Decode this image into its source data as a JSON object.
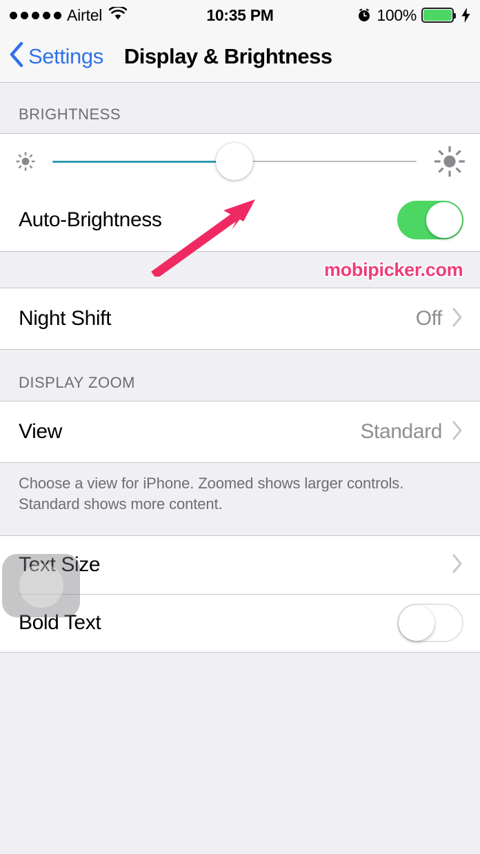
{
  "status_bar": {
    "signal_dots": 5,
    "carrier": "Airtel",
    "wifi_icon": "wifi-icon",
    "time": "10:35 PM",
    "alarm_icon": "alarm-clock-icon",
    "battery_percent": "100%",
    "battery_level": 100,
    "charging_icon": "lightning-bolt-icon",
    "battery_color": "#4cd764"
  },
  "nav_bar": {
    "back_icon": "chevron-left-icon",
    "back_label": "Settings",
    "title": "Display & Brightness",
    "tint_color": "#2f72e8"
  },
  "sections": {
    "brightness": {
      "header": "BRIGHTNESS",
      "slider": {
        "name": "brightness-slider",
        "min_icon": "sun-small-icon",
        "max_icon": "sun-large-icon",
        "value_percent": 50,
        "fill_color": "#2e9bb0",
        "track_color": "#b9b9bd"
      },
      "auto_brightness": {
        "label": "Auto-Brightness",
        "toggle_state": "on",
        "toggle_on_color": "#4cd764"
      }
    },
    "night_shift": {
      "label": "Night Shift",
      "value": "Off",
      "disclosure_icon": "chevron-right-icon"
    },
    "display_zoom": {
      "header": "DISPLAY ZOOM",
      "view": {
        "label": "View",
        "value": "Standard",
        "disclosure_icon": "chevron-right-icon"
      },
      "footer": "Choose a view for iPhone. Zoomed shows larger controls. Standard shows more content."
    },
    "text": {
      "text_size": {
        "label": "Text Size",
        "disclosure_icon": "chevron-right-icon"
      },
      "bold_text": {
        "label": "Bold Text",
        "toggle_state": "off"
      }
    }
  },
  "annotations": {
    "arrow": {
      "name": "pink-arrow-annotation",
      "color": "#ef2a63",
      "points_to": "brightness-slider-thumb"
    },
    "watermark": {
      "text": "mobipicker.com",
      "color": "#ef3d7a"
    },
    "assistive_touch": {
      "name": "assistive-touch-button"
    }
  }
}
